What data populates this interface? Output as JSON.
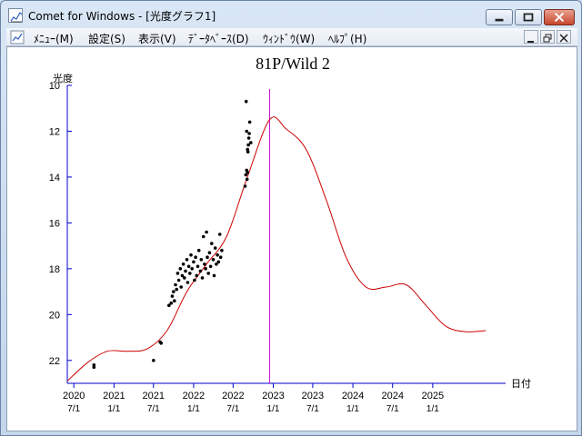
{
  "window": {
    "title": "Comet for Windows - [光度グラフ1]",
    "icon": "chart-document-icon"
  },
  "menu": {
    "items": [
      {
        "label": "ﾒﾆｭｰ(M)",
        "name": "menu-main"
      },
      {
        "label": "設定(S)",
        "name": "menu-settings"
      },
      {
        "label": "表示(V)",
        "name": "menu-view"
      },
      {
        "label": "ﾃﾞｰﾀﾍﾞｰｽ(D)",
        "name": "menu-database"
      },
      {
        "label": "ｳｨﾝﾄﾞｳ(W)",
        "name": "menu-window"
      },
      {
        "label": "ﾍﾙﾌﾟ(H)",
        "name": "menu-help"
      }
    ]
  },
  "colors": {
    "axis": "#0000cc",
    "curve": "#cc0000",
    "current_date_line": "#cc00cc",
    "observation": "#000000"
  },
  "chart_data": {
    "type": "scatter",
    "title": "81P/Wild 2",
    "ylabel": "光度",
    "xlabel": "日付",
    "y_inverted": true,
    "ylim": [
      10,
      23
    ],
    "y_ticks": [
      "10",
      "12",
      "14",
      "16",
      "18",
      "20",
      "22"
    ],
    "xlim": [
      "2020-06-01",
      "2025-12-01"
    ],
    "x_ticks": [
      {
        "date": "2020-07-01",
        "year": "2020",
        "md": "7/1"
      },
      {
        "date": "2021-01-01",
        "year": "2021",
        "md": "1/1"
      },
      {
        "date": "2021-07-01",
        "year": "2021",
        "md": "7/1"
      },
      {
        "date": "2022-01-01",
        "year": "2022",
        "md": "1/1"
      },
      {
        "date": "2022-07-01",
        "year": "2022",
        "md": "7/1"
      },
      {
        "date": "2023-01-01",
        "year": "2023",
        "md": "1/1"
      },
      {
        "date": "2023-07-01",
        "year": "2023",
        "md": "7/1"
      },
      {
        "date": "2024-01-01",
        "year": "2024",
        "md": "1/1"
      },
      {
        "date": "2024-07-01",
        "year": "2024",
        "md": "7/1"
      },
      {
        "date": "2025-01-01",
        "year": "2025",
        "md": "1/1"
      }
    ],
    "current_date": "2022-12-15",
    "series": [
      {
        "kind": "predicted-curve",
        "x": [
          "2020-06-01",
          "2020-09-01",
          "2020-12-01",
          "2021-03-01",
          "2021-06-01",
          "2021-09-01",
          "2021-12-01",
          "2022-03-01",
          "2022-06-01",
          "2022-09-01",
          "2022-12-15",
          "2023-03-01",
          "2023-06-01",
          "2023-09-01",
          "2023-12-01",
          "2024-03-01",
          "2024-06-01",
          "2024-09-01",
          "2024-12-01",
          "2025-03-01",
          "2025-06-01",
          "2025-09-01"
        ],
        "y": [
          22.9,
          22.1,
          21.6,
          21.6,
          21.5,
          20.7,
          19.0,
          17.8,
          16.6,
          14.1,
          11.5,
          11.9,
          12.8,
          15.0,
          17.5,
          18.8,
          18.8,
          18.7,
          19.6,
          20.5,
          20.75,
          20.7
        ]
      },
      {
        "kind": "observations",
        "points": [
          [
            "2020-10-01",
            22.2
          ],
          [
            "2020-10-01",
            22.3
          ],
          [
            "2021-07-01",
            22.0
          ],
          [
            "2021-08-01",
            21.2
          ],
          [
            "2021-08-05",
            21.25
          ],
          [
            "2021-09-10",
            19.6
          ],
          [
            "2021-09-20",
            19.5
          ],
          [
            "2021-09-25",
            19.2
          ],
          [
            "2021-10-01",
            19.0
          ],
          [
            "2021-10-05",
            19.4
          ],
          [
            "2021-10-10",
            18.7
          ],
          [
            "2021-10-15",
            18.9
          ],
          [
            "2021-10-20",
            18.2
          ],
          [
            "2021-10-25",
            18.5
          ],
          [
            "2021-11-01",
            18.0
          ],
          [
            "2021-11-05",
            18.8
          ],
          [
            "2021-11-10",
            18.3
          ],
          [
            "2021-11-15",
            17.8
          ],
          [
            "2021-11-20",
            18.4
          ],
          [
            "2021-11-25",
            18.1
          ],
          [
            "2021-12-01",
            17.6
          ],
          [
            "2021-12-05",
            18.6
          ],
          [
            "2021-12-10",
            17.9
          ],
          [
            "2021-12-15",
            18.2
          ],
          [
            "2021-12-20",
            17.4
          ],
          [
            "2021-12-25",
            18.0
          ],
          [
            "2022-01-01",
            17.7
          ],
          [
            "2022-01-05",
            18.5
          ],
          [
            "2022-01-10",
            17.5
          ],
          [
            "2022-01-15",
            18.3
          ],
          [
            "2022-01-20",
            17.9
          ],
          [
            "2022-01-25",
            17.2
          ],
          [
            "2022-02-01",
            18.1
          ],
          [
            "2022-02-05",
            17.6
          ],
          [
            "2022-02-10",
            18.4
          ],
          [
            "2022-02-15",
            16.6
          ],
          [
            "2022-02-20",
            17.8
          ],
          [
            "2022-02-25",
            18.0
          ],
          [
            "2022-03-01",
            16.4
          ],
          [
            "2022-03-05",
            17.5
          ],
          [
            "2022-03-10",
            18.2
          ],
          [
            "2022-03-15",
            17.3
          ],
          [
            "2022-03-20",
            17.9
          ],
          [
            "2022-03-25",
            16.9
          ],
          [
            "2022-04-01",
            17.6
          ],
          [
            "2022-04-05",
            18.3
          ],
          [
            "2022-04-10",
            17.1
          ],
          [
            "2022-04-15",
            17.8
          ],
          [
            "2022-04-20",
            17.4
          ],
          [
            "2022-04-25",
            17.7
          ],
          [
            "2022-05-01",
            16.5
          ],
          [
            "2022-05-05",
            17.5
          ],
          [
            "2022-05-10",
            17.2
          ],
          [
            "2022-08-25",
            14.4
          ],
          [
            "2022-08-28",
            13.9
          ],
          [
            "2022-09-01",
            13.7
          ],
          [
            "2022-09-03",
            14.1
          ],
          [
            "2022-09-05",
            13.8
          ],
          [
            "2022-09-07",
            12.9
          ],
          [
            "2022-09-09",
            12.6
          ],
          [
            "2022-09-11",
            12.3
          ],
          [
            "2022-09-13",
            12.1
          ],
          [
            "2022-09-05",
            12.8
          ],
          [
            "2022-09-01",
            12.0
          ],
          [
            "2022-09-15",
            11.6
          ],
          [
            "2022-09-20",
            12.5
          ],
          [
            "2022-08-30",
            10.7
          ]
        ]
      }
    ]
  }
}
